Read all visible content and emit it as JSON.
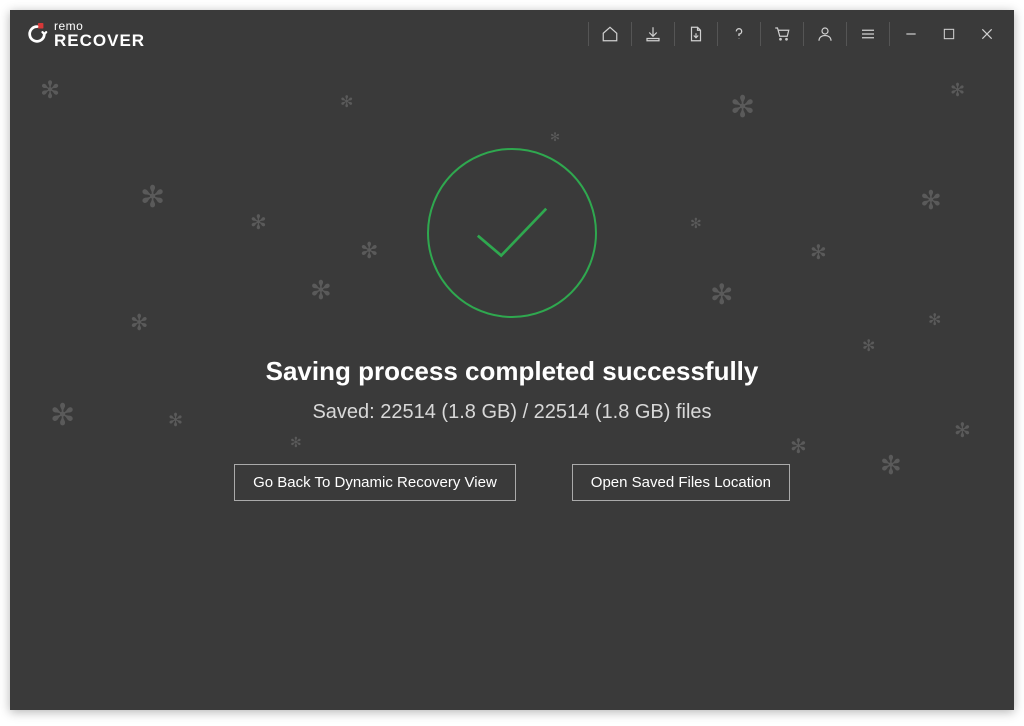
{
  "app": {
    "brand_top": "remo",
    "brand_bottom": "RECOVER"
  },
  "titlebar": {
    "home": "Home",
    "download": "Download",
    "export": "Export",
    "help": "Help",
    "cart": "Cart",
    "account": "Account",
    "menu": "Menu",
    "minimize": "Minimize",
    "maximize": "Maximize",
    "close": "Close"
  },
  "main": {
    "headline": "Saving process completed successfully",
    "subline": "Saved: 22514 (1.8 GB) / 22514 (1.8 GB) files",
    "go_back_label": "Go Back To Dynamic Recovery View",
    "open_location_label": "Open Saved Files Location"
  }
}
